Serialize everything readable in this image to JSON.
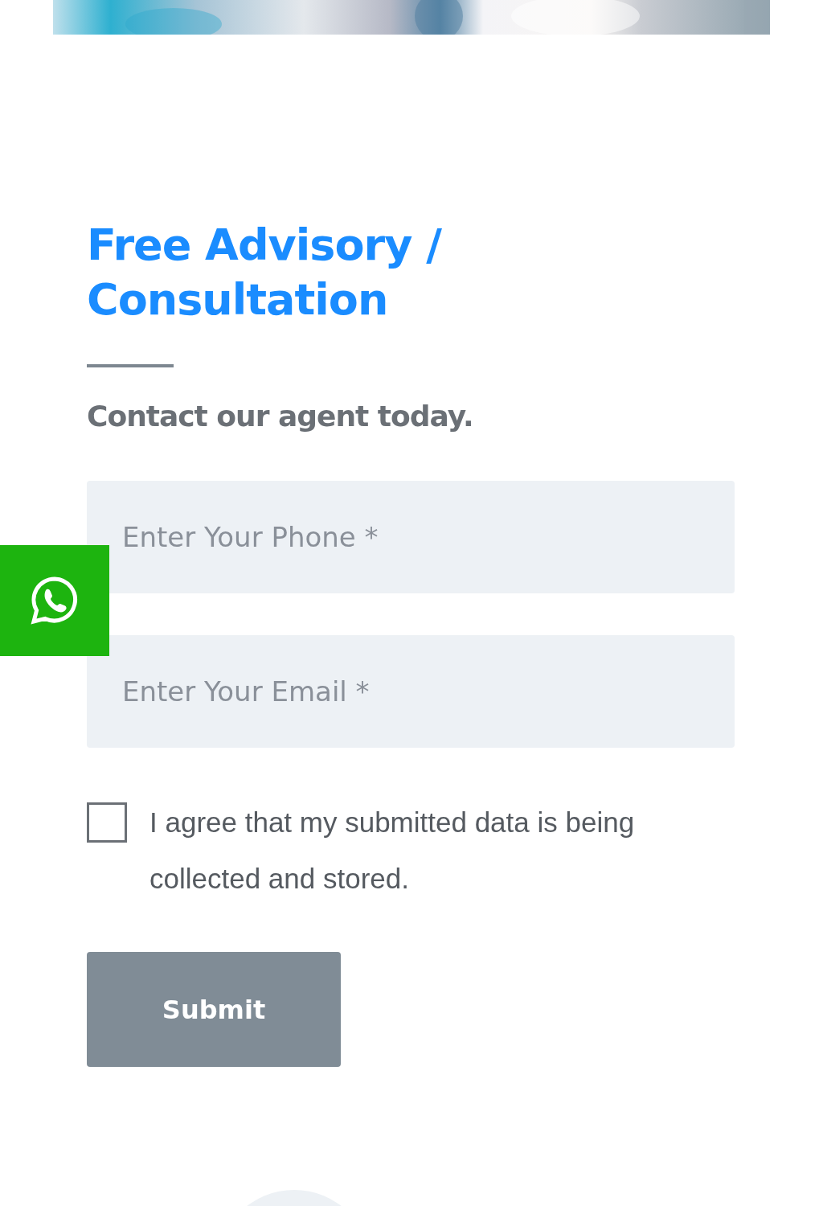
{
  "form": {
    "title": "Free Advisory / Consultation",
    "subtitle": "Contact our agent today.",
    "fields": [
      {
        "placeholder": "Enter Your Phone *"
      },
      {
        "placeholder": "Enter Your Email *"
      }
    ],
    "consent": {
      "checked": false,
      "label": "I agree that my submitted data is being collected and stored."
    },
    "submit": "Submit"
  },
  "whatsapp_button": {
    "kind": "chat"
  }
}
